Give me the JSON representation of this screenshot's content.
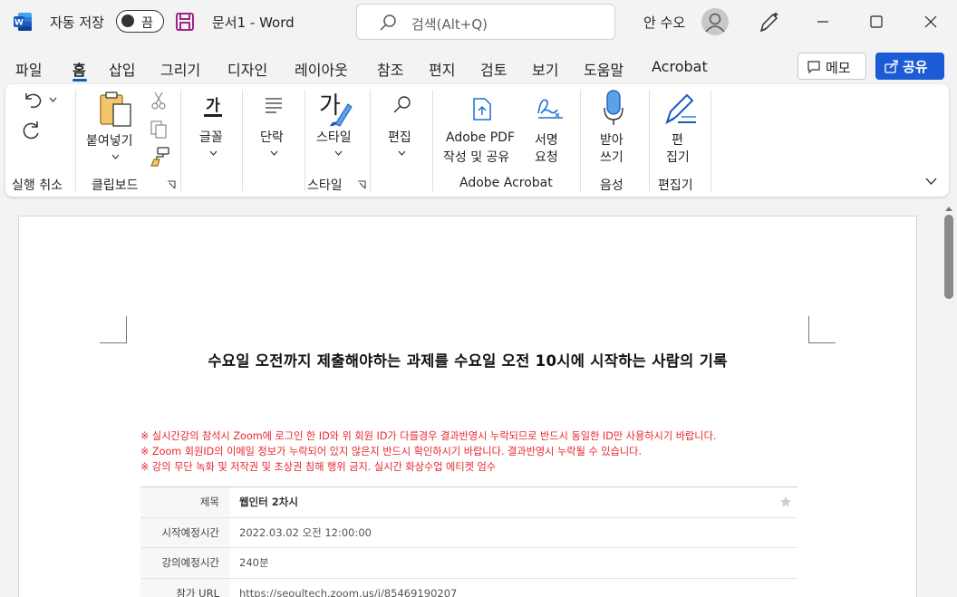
{
  "titlebar": {
    "autosave_label": "자동 저장",
    "autosave_state": "끔",
    "doc_name": "문서1  -  Word",
    "search_placeholder": "검색(Alt+Q)",
    "user_name": "안 수오"
  },
  "menu": {
    "tabs": [
      "파일",
      "홈",
      "삽입",
      "그리기",
      "디자인",
      "레이아웃",
      "참조",
      "편지",
      "검토",
      "보기",
      "도움말",
      "Acrobat"
    ],
    "active_tab": "홈",
    "memo_label": "메모",
    "share_label": "공유"
  },
  "ribbon": {
    "undo_group": "실행 취소",
    "paste_label": "붙여넣기",
    "clipboard_group": "클립보드",
    "font_label": "글꼴",
    "paragraph_label": "단락",
    "styles_label": "스타일",
    "styles_group": "스타일",
    "editing_label": "편집",
    "pdf_label_1": "Adobe PDF",
    "pdf_label_2": "작성 및 공유",
    "sign_label_1": "서명",
    "sign_label_2": "요청",
    "acrobat_group": "Adobe Acrobat",
    "dictate_label_1": "받아",
    "dictate_label_2": "쓰기",
    "voice_group": "음성",
    "editor_label_1": "편",
    "editor_label_2": "집기",
    "editor_group": "편집기"
  },
  "document": {
    "heading": "수요일 오전까지 제출해야하는 과제를 수요일 오전 10시에 시작하는 사람의 기록",
    "notices": [
      "※ 실시간강의 참석시 Zoom에 로그인 한 ID와 위 회원 ID가 다를경우 결과반영시 누락되므로 반드시 동일한 ID만 사용하시기 바랍니다.",
      "※ Zoom 회원ID의 이메일 정보가 누락되어 있지 않은지 반드시 확인하시기 바랍니다. 결과반영시 누락될 수 있습니다.",
      "※ 강의 무단 녹화 및 저작권 및 초상권 침해 행위 금지. 실시간 화상수업 에티켓 엄수"
    ],
    "table": [
      {
        "key": "제목",
        "value": "웹인터 2차시"
      },
      {
        "key": "시작예정시간",
        "value": "2022.03.02 오전 12:00:00"
      },
      {
        "key": "강의예정시간",
        "value": "240분"
      },
      {
        "key": "참가 URL",
        "value": "https://seoultech.zoom.us/j/85469190207"
      }
    ]
  },
  "colors": {
    "accent": "#185abd",
    "share_button": "#1c5bd6",
    "notice_red": "#e8262c",
    "word_blue": "#2b579a"
  },
  "icons": {
    "app": "word-logo-icon",
    "save": "save-icon",
    "search": "search-icon",
    "avatar": "user-avatar-icon",
    "coauthor": "pen-sparkle-icon"
  }
}
